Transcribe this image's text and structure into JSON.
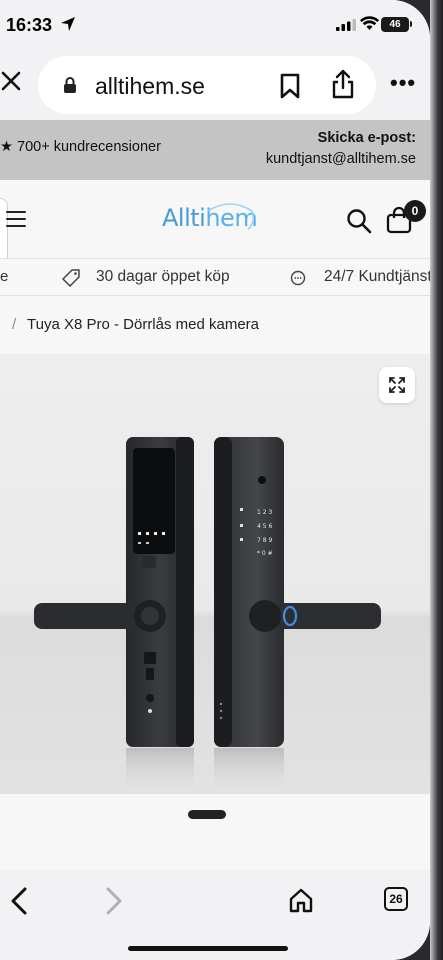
{
  "status_bar": {
    "time": "16:33",
    "battery": "46"
  },
  "browser": {
    "url": "alltihem.se",
    "more_label": "•••"
  },
  "info_bar": {
    "reviews_text": "★ 700+ kundrecensioner",
    "email_label": "Skicka e-post:",
    "email_address": "kundtjanst@alltihem.se"
  },
  "header": {
    "logo_part1": "Allti",
    "logo_part2": "hem",
    "cart_count": "0"
  },
  "usp_strip": {
    "fragment": "e",
    "item1": "30 dagar öppet köp",
    "item2": "24/7 Kundtjänst"
  },
  "breadcrumb": {
    "separator": "/",
    "current": "Tuya X8 Pro - Dörrlås med kamera"
  },
  "bottom_bar": {
    "tab_count": "26"
  },
  "colors": {
    "logo_blue": "#4a9ad6",
    "info_bar_bg": "#c4c4c4",
    "lock_body": "#2e3033"
  }
}
